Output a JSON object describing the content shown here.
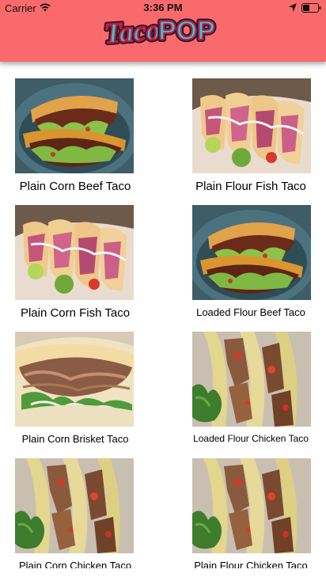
{
  "status_bar": {
    "carrier": "Carrier",
    "time": "3:36 PM"
  },
  "header": {
    "logo_word1": "Taco",
    "logo_word2": "POP",
    "bg_color": "#fa6a6d"
  },
  "tacos": [
    {
      "name": "Plain Corn Beef Taco",
      "photo": "beef-taco-photo"
    },
    {
      "name": "Plain Flour Fish Taco",
      "photo": "fish-taco-photo"
    },
    {
      "name": "Plain Corn Fish Taco",
      "photo": "fish-taco-photo"
    },
    {
      "name": "Loaded Flour Beef Taco",
      "photo": "beef-taco-photo"
    },
    {
      "name": "Plain Corn Brisket Taco",
      "photo": "brisket-taco-photo"
    },
    {
      "name": "Loaded Flour Chicken Taco",
      "photo": "chicken-taco-photo"
    },
    {
      "name": "Plain Corn Chicken Taco",
      "photo": "chicken-taco-photo"
    },
    {
      "name": "Plain Flour Chicken Taco",
      "photo": "chicken-taco-photo"
    }
  ]
}
